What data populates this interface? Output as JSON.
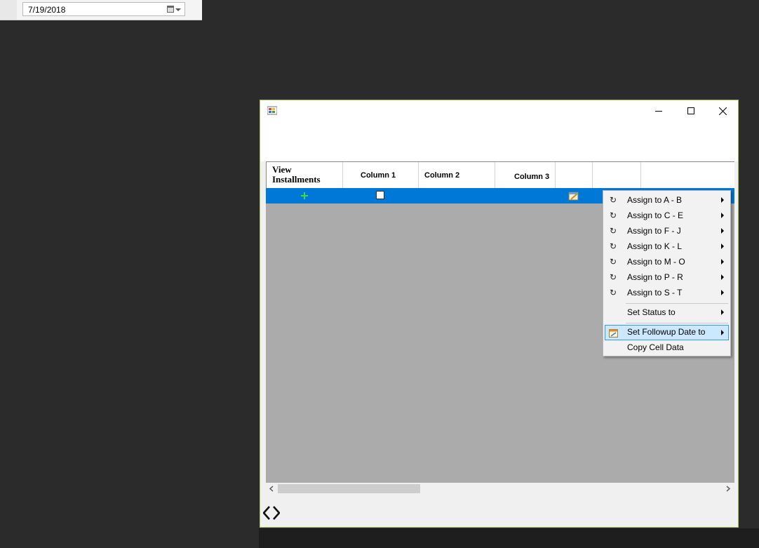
{
  "date_picker": {
    "value": "7/19/2018"
  },
  "grid": {
    "columns": [
      {
        "label": "View\nInstallments"
      },
      {
        "label": "Column 1"
      },
      {
        "label": "Column 2"
      },
      {
        "label": "Column 3"
      },
      {
        "label": ""
      },
      {
        "label": ""
      },
      {
        "label": ""
      }
    ],
    "row": {
      "col1_checked": false
    }
  },
  "context_menu": {
    "items": [
      {
        "label": "Assign to A - B",
        "icon": "refresh-icon",
        "has_submenu": true
      },
      {
        "label": "Assign to C - E",
        "icon": "refresh-icon",
        "has_submenu": true
      },
      {
        "label": "Assign to F - J",
        "icon": "refresh-icon",
        "has_submenu": true
      },
      {
        "label": "Assign to K - L",
        "icon": "refresh-icon",
        "has_submenu": true
      },
      {
        "label": "Assign to M - O",
        "icon": "refresh-icon",
        "has_submenu": true
      },
      {
        "label": "Assign to P - R",
        "icon": "refresh-icon",
        "has_submenu": true
      },
      {
        "label": "Assign to S - T",
        "icon": "refresh-icon",
        "has_submenu": true
      },
      {
        "label": "Set Status to",
        "icon": "",
        "has_submenu": true
      },
      {
        "label": "Set Followup Date to",
        "icon": "calendar-icon",
        "has_submenu": true,
        "highlighted": true
      },
      {
        "label": "Copy Cell Data",
        "icon": "",
        "has_submenu": false
      }
    ]
  },
  "colors": {
    "selection_blue": "#0078d7",
    "menu_highlight": "#cce8ff",
    "window_border": "#a5c25a",
    "grid_background": "#ababab"
  }
}
